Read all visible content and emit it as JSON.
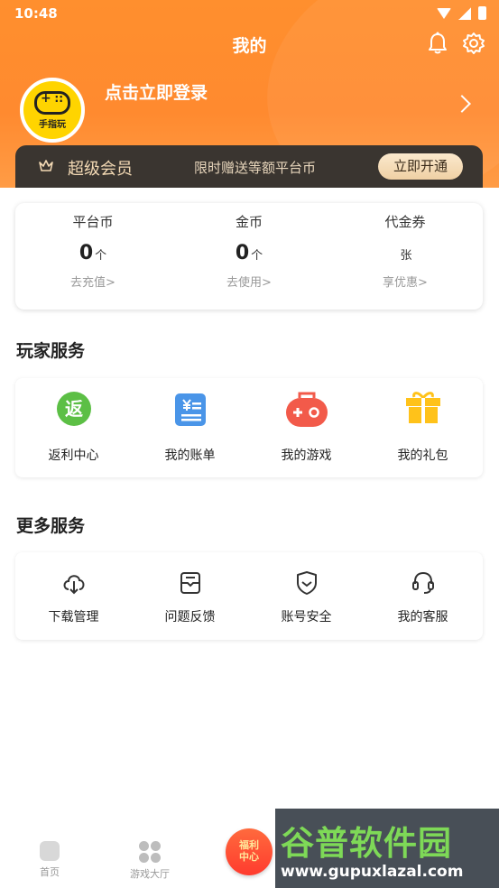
{
  "status_bar": {
    "time": "10:48"
  },
  "header": {
    "title": "我的",
    "avatar_text": "手指玩",
    "login_text": "点击立即登录"
  },
  "vip": {
    "title": "超级会员",
    "promo": "限时赠送等额平台币",
    "button": "立即开通"
  },
  "wallet": {
    "items": [
      {
        "label": "平台币",
        "value": "0",
        "unit": "个",
        "link": "去充值>"
      },
      {
        "label": "金币",
        "value": "0",
        "unit": "个",
        "link": "去使用>"
      },
      {
        "label": "代金券",
        "value": "",
        "unit": "张",
        "link": "享优惠>"
      }
    ]
  },
  "player_services": {
    "title": "玩家服务",
    "items": [
      {
        "label": "返利中心",
        "icon": "rebate-icon",
        "icon_text": "返",
        "color": "#5cbf45"
      },
      {
        "label": "我的账单",
        "icon": "bill-icon",
        "color": "#4a95e8"
      },
      {
        "label": "我的游戏",
        "icon": "gamepad-icon",
        "color": "#f25a4a"
      },
      {
        "label": "我的礼包",
        "icon": "gift-icon",
        "color": "#ffc21a"
      }
    ]
  },
  "more_services": {
    "title": "更多服务",
    "items": [
      {
        "label": "下载管理",
        "icon": "download-icon"
      },
      {
        "label": "问题反馈",
        "icon": "feedback-icon"
      },
      {
        "label": "账号安全",
        "icon": "shield-icon"
      },
      {
        "label": "我的客服",
        "icon": "headset-icon"
      }
    ]
  },
  "tabbar": {
    "items": [
      {
        "label": "首页",
        "icon": "home-icon"
      },
      {
        "label": "游戏大厅",
        "icon": "grid-icon"
      },
      {
        "label": "福利\n中心",
        "icon": "welfare-icon"
      }
    ]
  },
  "watermark": {
    "main": "谷普软件园",
    "url": "www.gupuxlazal.com"
  },
  "colors": {
    "accent": "#ff8c2f",
    "vip_bg": "#3a3530",
    "vip_gold": "#f3d9b4"
  }
}
